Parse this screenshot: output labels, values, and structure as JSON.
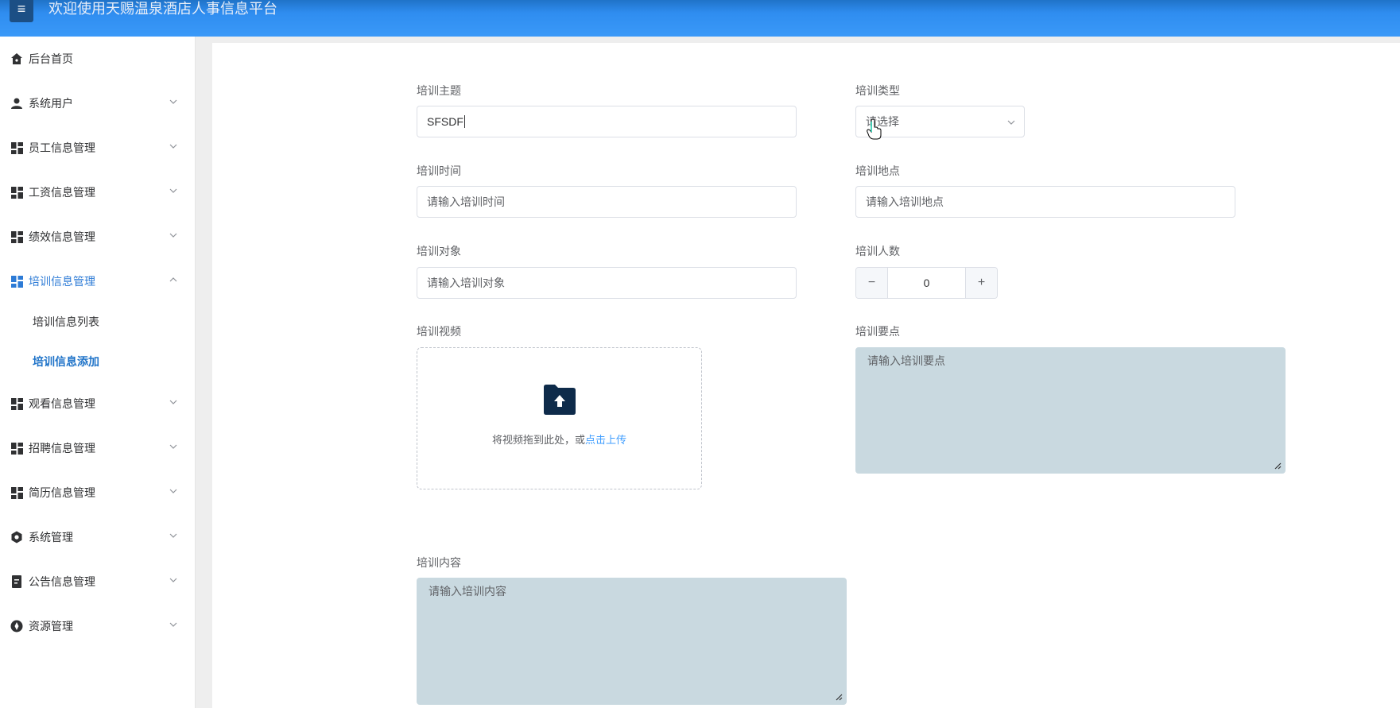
{
  "header": {
    "menu_icon": "hamburger-icon",
    "title": "欢迎使用天赐温泉酒店人事信息平台",
    "bg_color": "#2f8df0"
  },
  "sidebar": {
    "items": [
      {
        "label": "后台首页",
        "icon": "home-icon"
      },
      {
        "label": "系统用户",
        "icon": "user-icon"
      },
      {
        "label": "员工信息管理",
        "icon": "grid-icon"
      },
      {
        "label": "工资信息管理",
        "icon": "grid-icon"
      },
      {
        "label": "绩效信息管理",
        "icon": "grid-icon"
      },
      {
        "label": "培训信息管理",
        "icon": "grid-icon",
        "expanded": true
      },
      {
        "label": "观看信息管理",
        "icon": "grid-icon"
      },
      {
        "label": "招聘信息管理",
        "icon": "grid-icon"
      },
      {
        "label": "简历信息管理",
        "icon": "grid-icon"
      },
      {
        "label": "系统管理",
        "icon": "gear-icon"
      },
      {
        "label": "公告信息管理",
        "icon": "document-icon"
      },
      {
        "label": "资源管理",
        "icon": "compass-icon"
      }
    ],
    "subitems": [
      {
        "label": "培训信息列表"
      },
      {
        "label": "培训信息添加",
        "active": true
      }
    ],
    "active_color": "#1f73c8"
  },
  "form": {
    "topic": {
      "label": "培训主题",
      "value": "SFSDF"
    },
    "type": {
      "label": "培训类型",
      "placeholder": "请选择"
    },
    "time": {
      "label": "培训时间",
      "placeholder": "请输入培训时间"
    },
    "location": {
      "label": "培训地点",
      "placeholder": "请输入培训地点"
    },
    "target": {
      "label": "培训对象",
      "placeholder": "请输入培训对象"
    },
    "count": {
      "label": "培训人数",
      "value": "0",
      "minus": "−",
      "plus": "+"
    },
    "video": {
      "label": "培训视频",
      "upload_text": "将视频拖到此处，或",
      "upload_link": "点击上传",
      "icon": "folder-upload-icon"
    },
    "key_points": {
      "label": "培训要点",
      "placeholder": "请输入培训要点"
    },
    "content": {
      "label": "培训内容",
      "placeholder": "请输入培训内容"
    }
  },
  "colors": {
    "textarea_bg": "#c9d9e0",
    "link": "#409eff"
  }
}
